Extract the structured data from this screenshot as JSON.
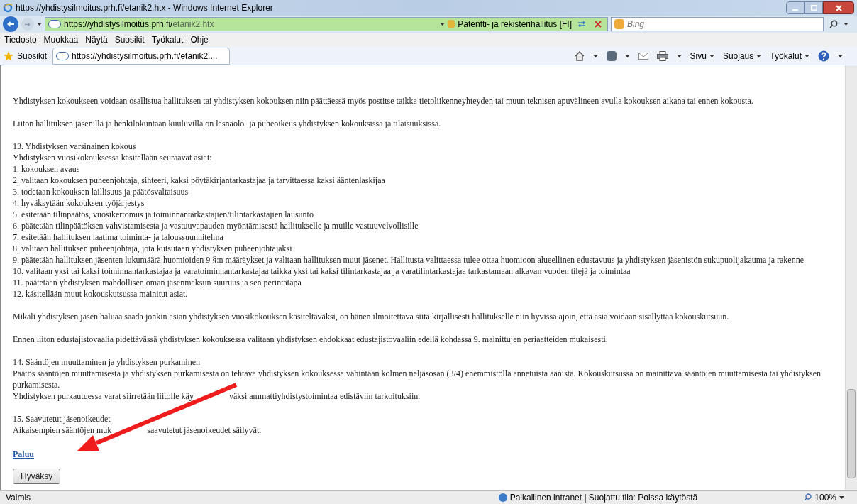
{
  "window": {
    "title": "https://yhdistysilmoitus.prh.fi/etanik2.htx - Windows Internet Explorer"
  },
  "address_bar": {
    "url_host": "https://yhdistysilmoitus.prh.fi/",
    "url_path": "etanik2.htx",
    "security": "Patentti- ja rekisterihallitus [FI]",
    "search_placeholder": "Bing"
  },
  "menu": [
    "Tiedosto",
    "Muokkaa",
    "Näytä",
    "Suosikit",
    "Työkalut",
    "Ohje"
  ],
  "favorites_bar": {
    "favorites": "Suosikit",
    "tab": "https://yhdistysilmoitus.prh.fi/etanik2....",
    "commands": [
      "Sivu",
      "Suojaus",
      "Työkalut"
    ]
  },
  "content": {
    "blocks": [
      [
        "Yhdistyksen kokoukseen voidaan osallistua hallituksen tai yhdistyksen kokouksen niin päättäessä myös postitse taikka tietoliikenneyhteyden tai muun teknisen apuvälineen avulla kokouksen aikana tai ennen kokousta."
      ],
      [
        "Liiton hallituksen jäsenillä ja henkilökuntaan kuuluvilla on läsnäolo- ja puheoikeus yhdistyksen kokouksissa ja tilaisuuksissa."
      ],
      [
        "13. Yhdistyksen varsinainen kokous",
        "Yhdistyksen vuosikokouksessa käsitellään seuraavat asiat:",
        "1. kokouksen avaus",
        "2. valitaan kokouksen puheenjohtaja, sihteeri, kaksi pöytäkirjantarkastajaa ja tarvittaessa kaksi ääntenlaskijaa",
        "3. todetaan kokouksen laillisuus ja päätösvaltaisuus",
        "4. hyväksytään kokouksen työjärjestys",
        "5. esitetään tilinpäätös, vuosikertomus ja toiminnantarkastajien/tilintarkastajien lausunto",
        "6. päätetään tilinpäätöksen vahvistamisesta ja vastuuvapauden myöntämisestä hallitukselle ja muille vastuuvelvollisille",
        "7. esitetään hallituksen laatima toiminta- ja taloussuunnitelma",
        "8. valitaan hallituksen puheenjohtaja, jota kutsutaan yhdistyksen puheenjohtajaksi",
        "9. päätetään hallituksen jäsenten lukumäärä huomioiden 9 §:n määräykset ja valitaan hallituksen muut jäsenet. Hallitusta valittaessa tulee ottaa huomioon alueellinen edustavuus ja yhdistyksen jäsenistön sukupuolijakauma ja rakenne",
        "10. valitaan yksi tai kaksi toiminnantarkastajaa ja varatoiminnantarkastajaa taikka yksi tai kaksi tilintarkastajaa ja varatilintarkastajaa tarkastamaan alkavan vuoden tilejä ja toimintaa",
        "11. päätetään yhdistyksen mahdollisen oman jäsenmaksun suuruus ja sen perintätapa",
        "12. käsitellään muut kokouskutsussa mainitut asiat."
      ],
      [
        "Mikäli yhdistyksen jäsen haluaa saada jonkin asian yhdistyksen vuosikokouksen käsiteltäväksi, on hänen ilmoitettava siitä kirjallisesti hallitukselle niin hyvissä ajoin, että asia voidaan sisällyttää kokouskutsuun."
      ],
      [
        "Ennen liiton edustajistovaalia pidettävässä yhdistyksen kokouksessa valitaan yhdistyksen ehdokkaat edustajistovaaliin edellä kohdassa 9. mainittujen periaatteiden mukaisesti."
      ],
      [
        "14. Sääntöjen muuttaminen ja yhdistyksen purkaminen",
        "Päätös sääntöjen muuttamisesta ja yhdistyksen purkamisesta on tehtävä yhdistyksen kokouksessa vähintään kolmen neljäsosan (3/4) enemmistöllä annetuista äänistä. Kokouskutsussa on mainittava sääntöjen muuttamisesta tai yhdistyksen purkamisesta.",
        [
          "Yhdistyksen purkautuessa varat siirretään liitolle käy",
          "väksi ammattiyhdistystoimintaa edistäviin tarkoituksiin."
        ]
      ],
      [
        "15. Saavutetut jäsenoikeudet",
        [
          "Aikaisempien sääntöjen muk",
          "saavutetut jäsenoikeudet säilyvät."
        ]
      ]
    ],
    "link": "Paluu",
    "button": "Hyväksy"
  },
  "status_bar": {
    "status": "Valmis",
    "zone": "Paikallinen intranet | Suojattu tila: Poissa käytöstä",
    "zoom": "100%"
  }
}
